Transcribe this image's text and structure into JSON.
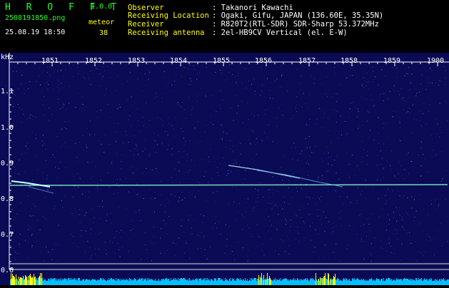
{
  "header": {
    "app_title": "H R O F F T",
    "version": "1.0.0",
    "file_name": "2508191850.png",
    "date_time": "25.08.19 18:50",
    "mode_label": "meteor",
    "meteor_count": "38",
    "info": [
      {
        "label": "Observer",
        "value": ": Takanori Kawachi"
      },
      {
        "label": "Receiving Location",
        "value": ": Ogaki, Gifu, JAPAN (136.60E, 35.35N)"
      },
      {
        "label": "Receiver",
        "value": ": R820T2(RTL-SDR) SDR-Sharp 53.372MHz"
      },
      {
        "label": "Receiving antenna",
        "value": ": 2el-HB9CV Vertical (el. E-W)"
      }
    ]
  },
  "plot": {
    "unit_label": "kHz",
    "time_ticks": [
      "1851",
      "1852",
      "1853",
      "1854",
      "1855",
      "1856",
      "1857",
      "1858",
      "1859",
      "1900"
    ],
    "freq_ticks": [
      "1.1",
      "1.0",
      "0.9",
      "0.8",
      "0.7",
      "0.6"
    ],
    "colors": {
      "background": "#0a0a55",
      "carrier": "#88ffcc",
      "meteor": "#ccffff",
      "noise_floor": "#00bfff",
      "noise_peak": "#ffff00"
    }
  }
}
